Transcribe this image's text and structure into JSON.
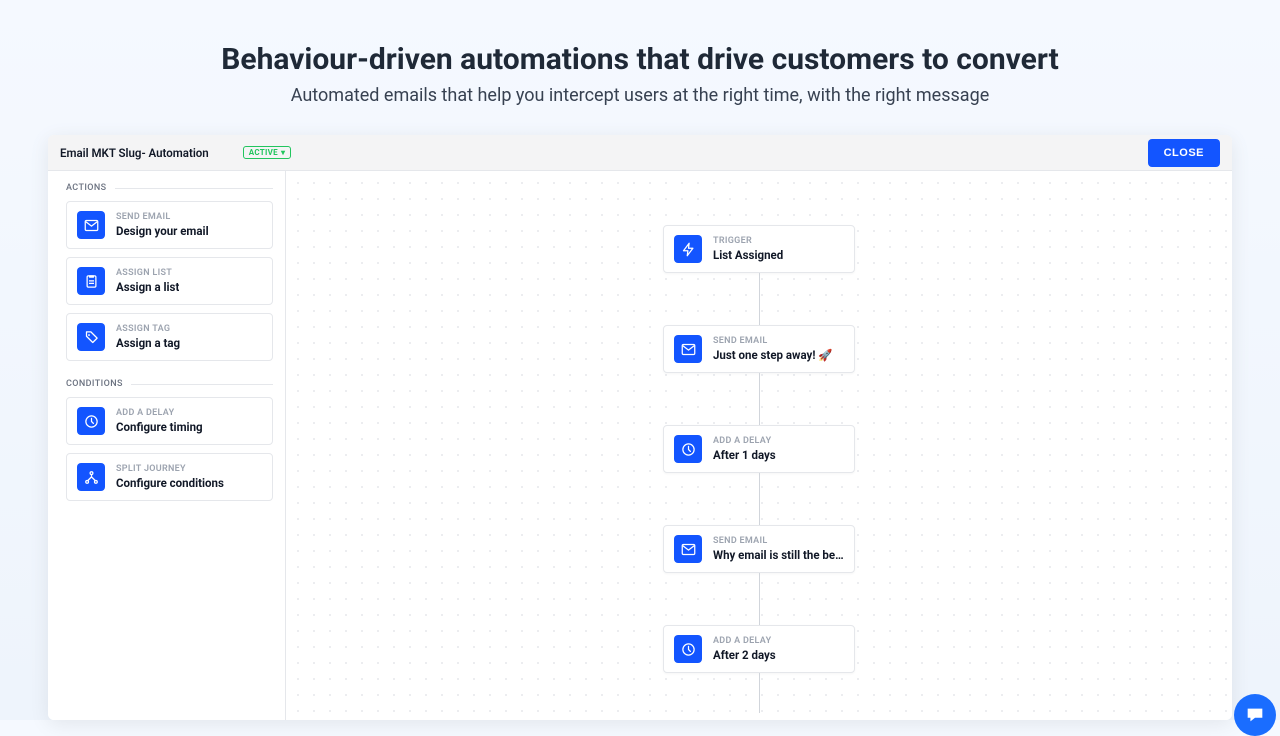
{
  "hero": {
    "title": "Behaviour-driven automations that drive customers to convert",
    "subtitle": "Automated emails that help you intercept users at the right time, with the right message"
  },
  "app": {
    "title": "Email MKT Slug- Automation",
    "status": "ACTIVE",
    "close_label": "CLOSE"
  },
  "sidebar": {
    "sections": [
      {
        "label": "ACTIONS",
        "items": [
          {
            "icon": "mail",
            "kicker": "SEND EMAIL",
            "title": "Design your email"
          },
          {
            "icon": "list",
            "kicker": "ASSIGN LIST",
            "title": "Assign a list"
          },
          {
            "icon": "tag",
            "kicker": "ASSIGN TAG",
            "title": "Assign a tag"
          }
        ]
      },
      {
        "label": "CONDITIONS",
        "items": [
          {
            "icon": "clock",
            "kicker": "ADD A DELAY",
            "title": "Configure timing"
          },
          {
            "icon": "split",
            "kicker": "SPLIT JOURNEY",
            "title": "Configure conditions"
          }
        ]
      }
    ]
  },
  "flow": {
    "nodes": [
      {
        "icon": "trigger",
        "kicker": "TRIGGER",
        "title": "List Assigned"
      },
      {
        "icon": "mail",
        "kicker": "SEND EMAIL",
        "title": "Just one step away! 🚀"
      },
      {
        "icon": "clock",
        "kicker": "ADD A DELAY",
        "title": "After 1 days"
      },
      {
        "icon": "mail",
        "kicker": "SEND EMAIL",
        "title": "Why email is still the best wa…"
      },
      {
        "icon": "clock",
        "kicker": "ADD A DELAY",
        "title": "After 2 days"
      }
    ]
  }
}
